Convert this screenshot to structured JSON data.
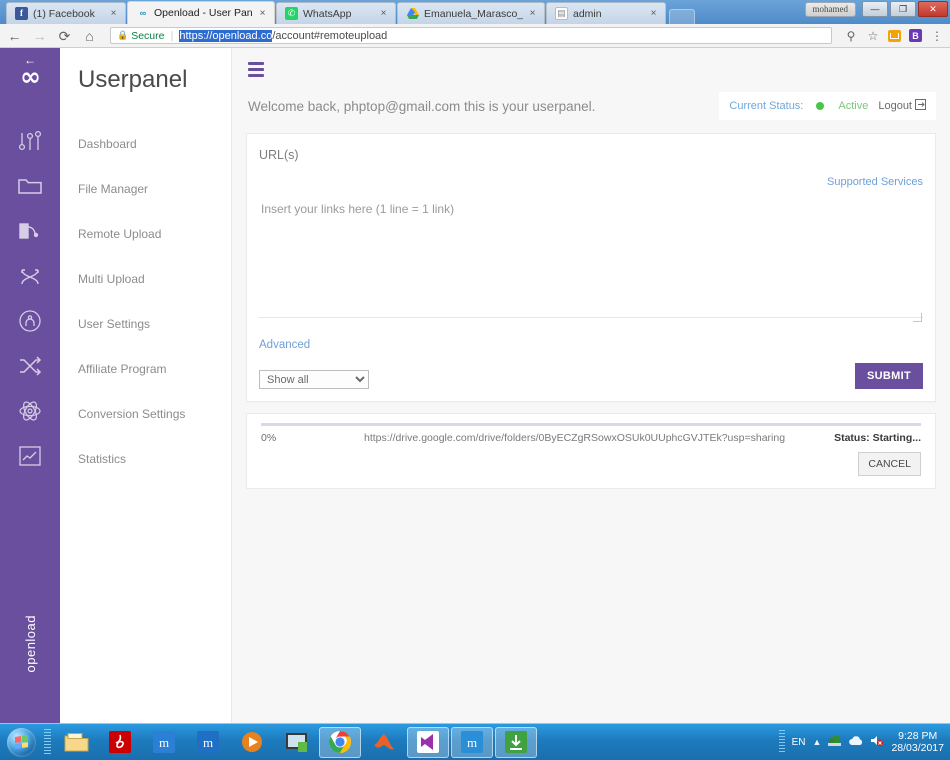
{
  "browser": {
    "window_user": "mohamed",
    "tabs": [
      {
        "title": "(1) Facebook",
        "favicon": "facebook-icon",
        "active": false
      },
      {
        "title": "Openload - User Panel",
        "favicon": "openload-icon",
        "active": true
      },
      {
        "title": "WhatsApp",
        "favicon": "whatsapp-icon",
        "active": false
      },
      {
        "title": "Emanuela_Marasco_sma",
        "favicon": "google-drive-icon",
        "active": false
      },
      {
        "title": "admin",
        "favicon": "document-icon",
        "active": false
      }
    ],
    "tab_close_label": "×",
    "window_controls": {
      "minimize": "—",
      "maximize": "❐",
      "close": "✕"
    },
    "nav": {
      "back": "←",
      "forward": "→",
      "reload": "C",
      "home": "⌂"
    },
    "omnibox": {
      "lock_icon": "lock-icon",
      "secure_label": "Secure",
      "url_selected": "https://openload.co",
      "url_rest": "/account#remoteupload"
    },
    "toolbar_icons": [
      "cast-icon",
      "star-icon",
      "extension-orange-icon",
      "extension-b-icon",
      "menu-dots-icon"
    ]
  },
  "sidebar": {
    "brand": "openload",
    "back_arrow": "←",
    "logo": "∞",
    "icons": [
      "sliders-icon",
      "folder-icon",
      "remote-upload-icon",
      "multi-upload-icon",
      "user-icon",
      "shuffle-icon",
      "atom-icon",
      "chart-icon"
    ]
  },
  "nav_panel": {
    "title": "Userpanel",
    "items": [
      {
        "label": "Dashboard"
      },
      {
        "label": "File Manager"
      },
      {
        "label": "Remote Upload"
      },
      {
        "label": "Multi Upload"
      },
      {
        "label": "User Settings"
      },
      {
        "label": "Affiliate Program"
      },
      {
        "label": "Conversion Settings"
      },
      {
        "label": "Statistics"
      }
    ]
  },
  "header": {
    "hamburger": "menu-icon",
    "welcome": "Welcome back, phptop@gmail.com this is your userpanel.",
    "current_status_label": "Current Status:",
    "status_value": "Active",
    "status_color": "#49c64a",
    "logout_label": "Logout"
  },
  "upload_card": {
    "urls_label": "URL(s)",
    "supported_services": "Supported Services",
    "textarea_placeholder": "Insert your links here (1 line = 1 link)",
    "textarea_value": "",
    "advanced_label": "Advanced",
    "select_value": "Show all",
    "select_options": [
      "Show all"
    ],
    "submit_label": "SUBMIT"
  },
  "progress_card": {
    "percent_label": "0%",
    "percent_value": 0,
    "url": "https://drive.google.com/drive/folders/0ByECZgRSowxOSUk0UUphcGVJTEk?usp=sharing",
    "status_label": "Status: Starting...",
    "cancel_label": "CANCEL"
  },
  "taskbar": {
    "start": "start-orb-icon",
    "buttons": [
      "explorer-icon",
      "adobe-reader-icon",
      "maxthon-icon",
      "maxthon2-icon",
      "media-player-icon",
      "screen-capture-icon",
      "chrome-icon",
      "matlab-icon",
      "visual-studio-icon",
      "maxthon3-icon",
      "downloader-icon"
    ],
    "tray": {
      "language": "EN",
      "show_hidden": "▲",
      "icons": [
        "network-icon",
        "cloud-icon",
        "volume-muted-icon"
      ],
      "time": "9:28 PM",
      "date": "28/03/2017"
    }
  },
  "colors": {
    "brand_purple": "#6a4f9e",
    "accent_blue": "#6f9fd8",
    "status_green": "#49c64a"
  }
}
